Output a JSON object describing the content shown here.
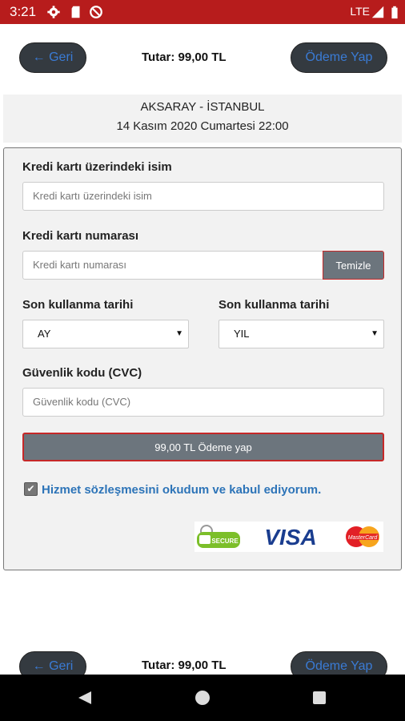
{
  "status_bar": {
    "time": "3:21",
    "network": "LTE"
  },
  "header": {
    "back_label": "← Geri",
    "amount": "Tutar: 99,00 TL",
    "pay_label": "Ödeme Yap"
  },
  "trip": {
    "route": "AKSARAY - İSTANBUL",
    "datetime": "14 Kasım 2020 Cumartesi 22:00"
  },
  "form": {
    "name_label": "Kredi kartı üzerindeki isim",
    "name_placeholder": "Kredi kartı üzerindeki isim",
    "number_label": "Kredi kartı numarası",
    "number_placeholder": "Kredi kartı numarası",
    "clear_label": "Temizle",
    "month_label": "Son kullanma tarihi",
    "month_value": "AY",
    "year_label": "Son kullanma tarihi",
    "year_value": "YIL",
    "cvc_label": "Güvenlik kodu (CVC)",
    "cvc_placeholder": "Güvenlik kodu (CVC)",
    "pay_button": "99,00 TL Ödeme yap",
    "terms": "Hizmet sözleşmesini okudum ve kabul ediyorum.",
    "terms_checked": true
  },
  "logos": {
    "secure": "SECURE",
    "visa": "VISA",
    "mastercard": "MasterCard"
  },
  "footer": {
    "back_label": "← Geri",
    "amount": "Tutar: 99,00 TL",
    "pay_label": "Ödeme Yap"
  },
  "colors": {
    "status_bar": "#b71c1c",
    "accent_link": "#2d74b8",
    "pill": "#343a40",
    "button_gray": "#6c757d"
  }
}
